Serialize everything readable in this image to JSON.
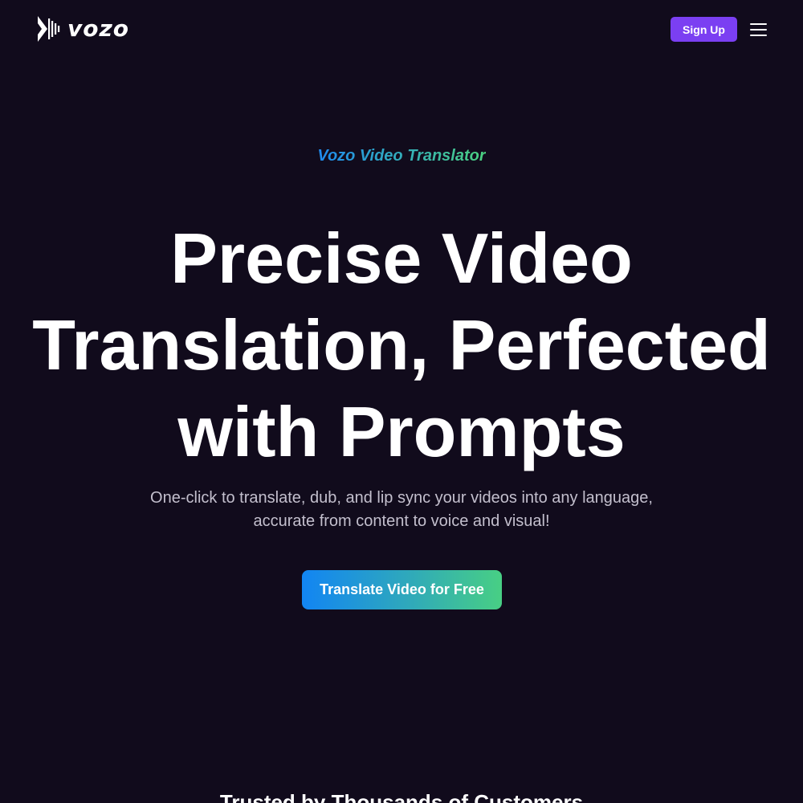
{
  "header": {
    "logo_text": "vozo",
    "signup_label": "Sign Up",
    "menu_icon": "hamburger-menu-icon"
  },
  "hero": {
    "eyebrow": "Vozo Video Translator",
    "headline_lines": [
      "Precise Video",
      "Translation, Perfected",
      "with Prompts"
    ],
    "subtext_lines": [
      "One-click to translate, dub, and lip sync your videos into any language,",
      "accurate from content to voice and visual!"
    ],
    "cta_label": "Translate Video for Free"
  },
  "trusted": {
    "heading": "Trusted by Thousands of Customers"
  },
  "colors": {
    "background": "#110b1c",
    "signup_button": "#7b3ff2",
    "gradient_start": "#1285f3",
    "gradient_end": "#48cf84",
    "subtext": "#c3bfcd"
  }
}
